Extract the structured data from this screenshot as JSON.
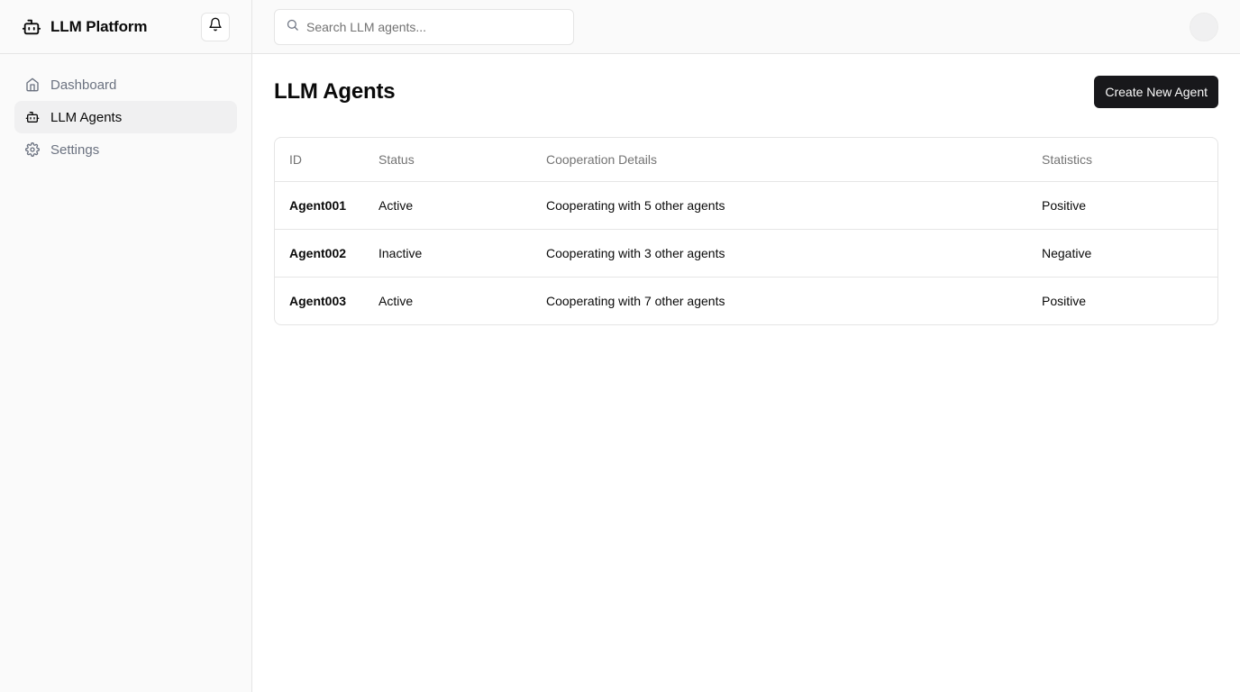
{
  "app": {
    "brand": "LLM Platform"
  },
  "sidebar": {
    "items": [
      {
        "label": "Dashboard",
        "icon": "home-icon",
        "active": false
      },
      {
        "label": "LLM Agents",
        "icon": "bot-icon",
        "active": true
      },
      {
        "label": "Settings",
        "icon": "gear-icon",
        "active": false
      }
    ]
  },
  "topbar": {
    "search_placeholder": "Search LLM agents..."
  },
  "page": {
    "title": "LLM Agents",
    "create_button": "Create New Agent"
  },
  "table": {
    "headers": {
      "id": "ID",
      "status": "Status",
      "cooperation": "Cooperation Details",
      "statistics": "Statistics"
    },
    "rows": [
      {
        "id": "Agent001",
        "status": "Active",
        "cooperation": "Cooperating with 5 other agents",
        "statistics": "Positive"
      },
      {
        "id": "Agent002",
        "status": "Inactive",
        "cooperation": "Cooperating with 3 other agents",
        "statistics": "Negative"
      },
      {
        "id": "Agent003",
        "status": "Active",
        "cooperation": "Cooperating with 7 other agents",
        "statistics": "Positive"
      }
    ]
  },
  "colors": {
    "primary_button": "#18181b",
    "active_nav_bg": "#f0f0f1",
    "sidebar_bg": "#fafafa",
    "border": "#e5e5e5",
    "muted_text": "#737373"
  }
}
